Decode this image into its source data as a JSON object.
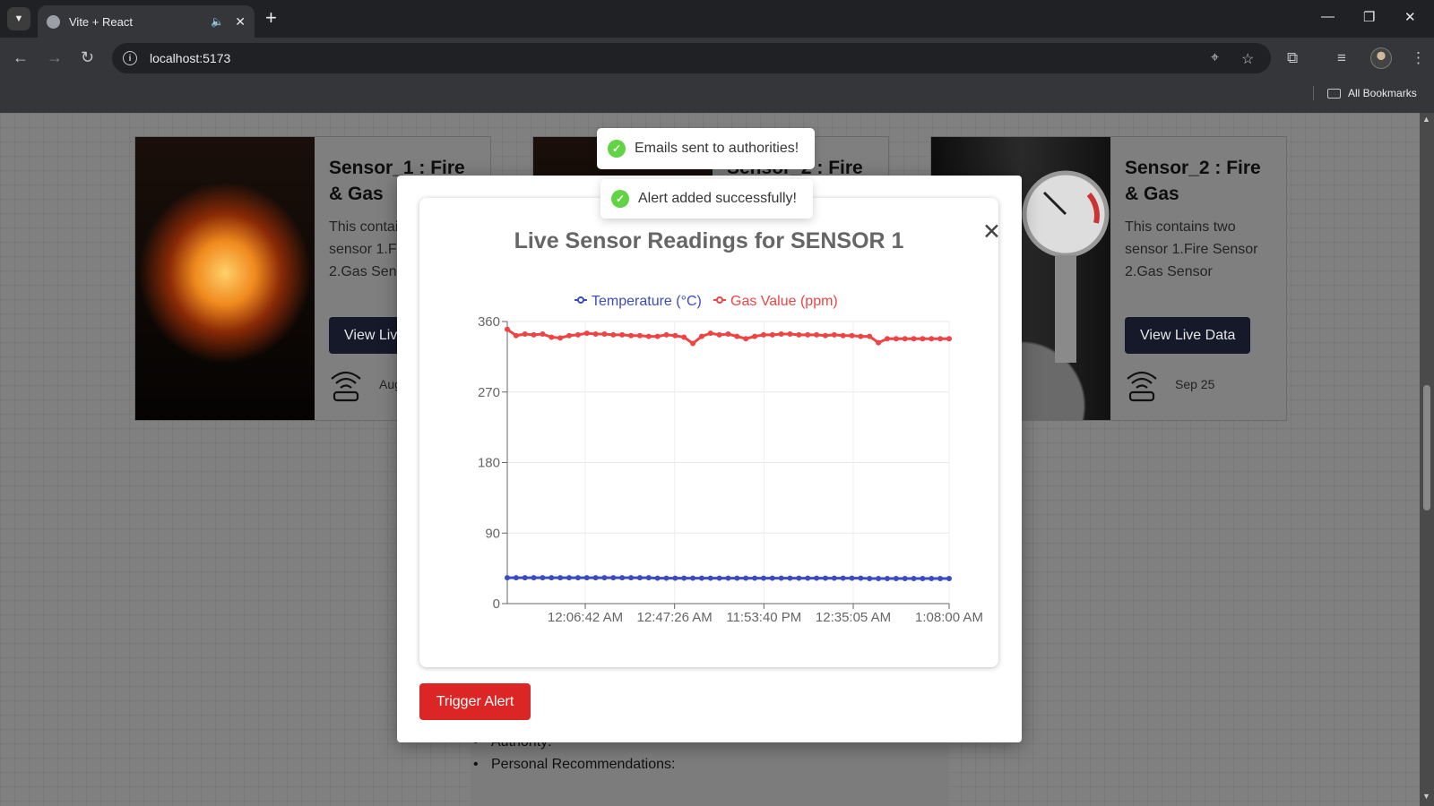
{
  "browser": {
    "tab_title": "Vite + React",
    "tab_close": "✕",
    "new_tab": "+",
    "url": "localhost:5173",
    "bookmarks_label": "All Bookmarks",
    "window_controls": {
      "minimize": "—",
      "restore": "❐",
      "close": "✕"
    }
  },
  "cards": [
    {
      "title": "Sensor_1 : Fire & Gas",
      "description": "This contains two sensor 1.Fire Sensor 2.Gas Sensor",
      "button": "View Live Data",
      "date": "Aug",
      "image": "burning-house"
    },
    {
      "title": "Sensor_2 : Fire",
      "image": "fire"
    },
    {
      "title": "Sensor_2 : Fire & Gas",
      "description": "This contains two sensor 1.Fire Sensor 2.Gas Sensor",
      "button": "View Live Data",
      "date": "Sep 25",
      "image": "pressure-gauge"
    }
  ],
  "details": {
    "items": [
      "Authority:",
      "Personal Recommendations:"
    ]
  },
  "toasts": [
    {
      "message": "Emails sent to authorities!"
    },
    {
      "message": "Alert added successfully!"
    }
  ],
  "modal": {
    "close": "✕",
    "title": "Live Sensor Readings for SENSOR 1",
    "trigger_button": "Trigger Alert"
  },
  "colors": {
    "temperature": "#3b4cc0",
    "gas": "#ef4444",
    "trigger": "#dc2626",
    "toast_check": "#61d345"
  },
  "chart_data": {
    "type": "line",
    "title": "Live Sensor Readings for SENSOR 1",
    "ylim": [
      0,
      360
    ],
    "yticks": [
      0,
      90,
      180,
      270,
      360
    ],
    "xtick_labels": [
      "12:06:42 AM",
      "12:47:26 AM",
      "11:53:40 PM",
      "12:35:05 AM",
      "1:08:00 AM"
    ],
    "legend_position": "top-center",
    "grid": true,
    "series": [
      {
        "name": "Temperature (°C)",
        "color": "#3b4cc0",
        "values": [
          33,
          33,
          33,
          33,
          33,
          33,
          33,
          33,
          33,
          33,
          33,
          33,
          33,
          33,
          33,
          33,
          33,
          32.5,
          32.5,
          32.5,
          32.5,
          32.5,
          32.5,
          32.5,
          32.5,
          32.5,
          32.5,
          32.5,
          32.5,
          32.5,
          32.5,
          32.5,
          32.5,
          32.5,
          32.5,
          32.5,
          32.5,
          32.5,
          32.5,
          32.5,
          32.5,
          32,
          32,
          32,
          32,
          32,
          32,
          32,
          32,
          32,
          32
        ]
      },
      {
        "name": "Gas Value (ppm)",
        "color": "#ef4444",
        "values": [
          350,
          342,
          344,
          343,
          344,
          340,
          339,
          342,
          343,
          345,
          344,
          344,
          343,
          343,
          342,
          342,
          341,
          341,
          343,
          342,
          340,
          332,
          341,
          345,
          343,
          344,
          341,
          338,
          341,
          343,
          343,
          344,
          344,
          343,
          343,
          343,
          342,
          343,
          342,
          342,
          341,
          341,
          333,
          338,
          338,
          338,
          338,
          338,
          338,
          338,
          338
        ]
      }
    ]
  }
}
